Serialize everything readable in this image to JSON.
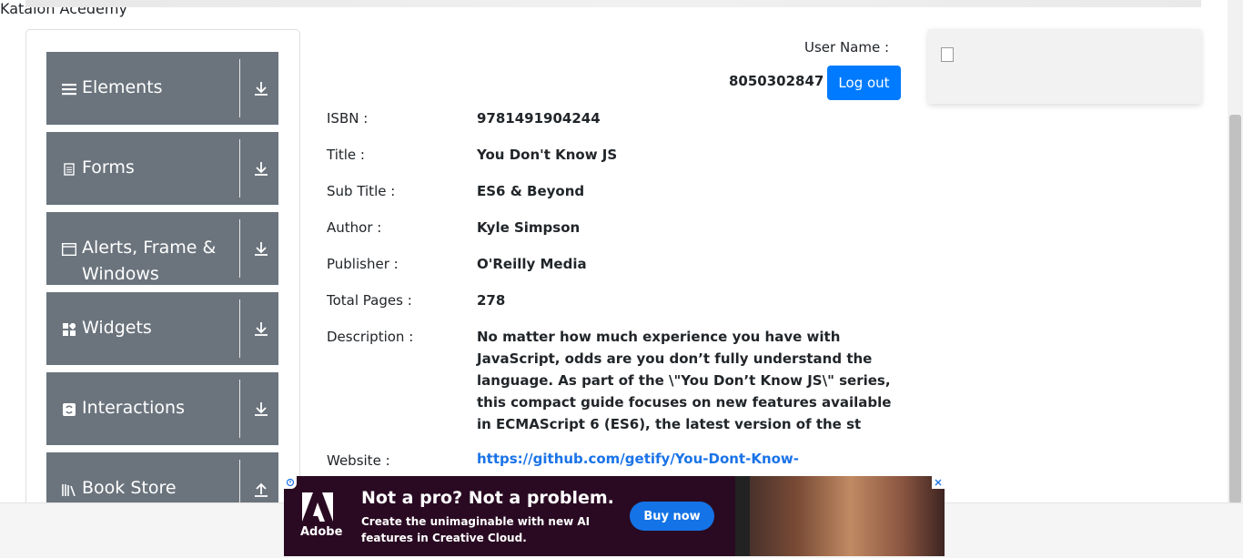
{
  "sidebar": {
    "groups": [
      {
        "label": "Elements",
        "icon": "list-icon"
      },
      {
        "label": "Forms",
        "icon": "document-icon"
      },
      {
        "label": "Alerts, Frame &",
        "label2": "Windows",
        "icon": "window-icon"
      },
      {
        "label": "Widgets",
        "icon": "widgets-icon"
      },
      {
        "label": "Interactions",
        "icon": "interactions-icon"
      },
      {
        "label": "Book Store",
        "icon": "books-icon"
      }
    ]
  },
  "user": {
    "label": "User Name :",
    "value": "8050302847",
    "logout_label": "Log out"
  },
  "book": {
    "fields": [
      {
        "label": "ISBN :",
        "value": "9781491904244"
      },
      {
        "label": "Title :",
        "value": "You Don't Know JS"
      },
      {
        "label": "Sub Title :",
        "value": "ES6 & Beyond"
      },
      {
        "label": "Author :",
        "value": "Kyle Simpson"
      },
      {
        "label": "Publisher :",
        "value": "O'Reilly Media"
      },
      {
        "label": "Total Pages :",
        "value": "278"
      }
    ],
    "description_label": "Description :",
    "description": "No matter how much experience you have with JavaScript, odds are you don’t fully understand the language. As part of the \\\"You Don’t Know JS\\\" series, this compact guide focuses on new features available in ECMAScript 6 (ES6), the latest version of the st",
    "website_label": "Website :",
    "website": "https://github.com/getify/You-Dont-Know-"
  },
  "banner": {
    "alt_text": "Katalon Acedemy"
  },
  "ad": {
    "brand": "Adobe",
    "headline": "Not a pro? Not a problem.",
    "subline": "Create the unimaginable with new AI features in Creative Cloud.",
    "cta": "Buy now",
    "close_icon": "close-icon",
    "adchoices_icon": "adchoices-icon"
  },
  "colors": {
    "group_bg": "#6b747d",
    "primary": "#007bff",
    "link": "#1a73e8",
    "ad_bg": "#2a0a22",
    "ad_cta": "#1473e6"
  }
}
